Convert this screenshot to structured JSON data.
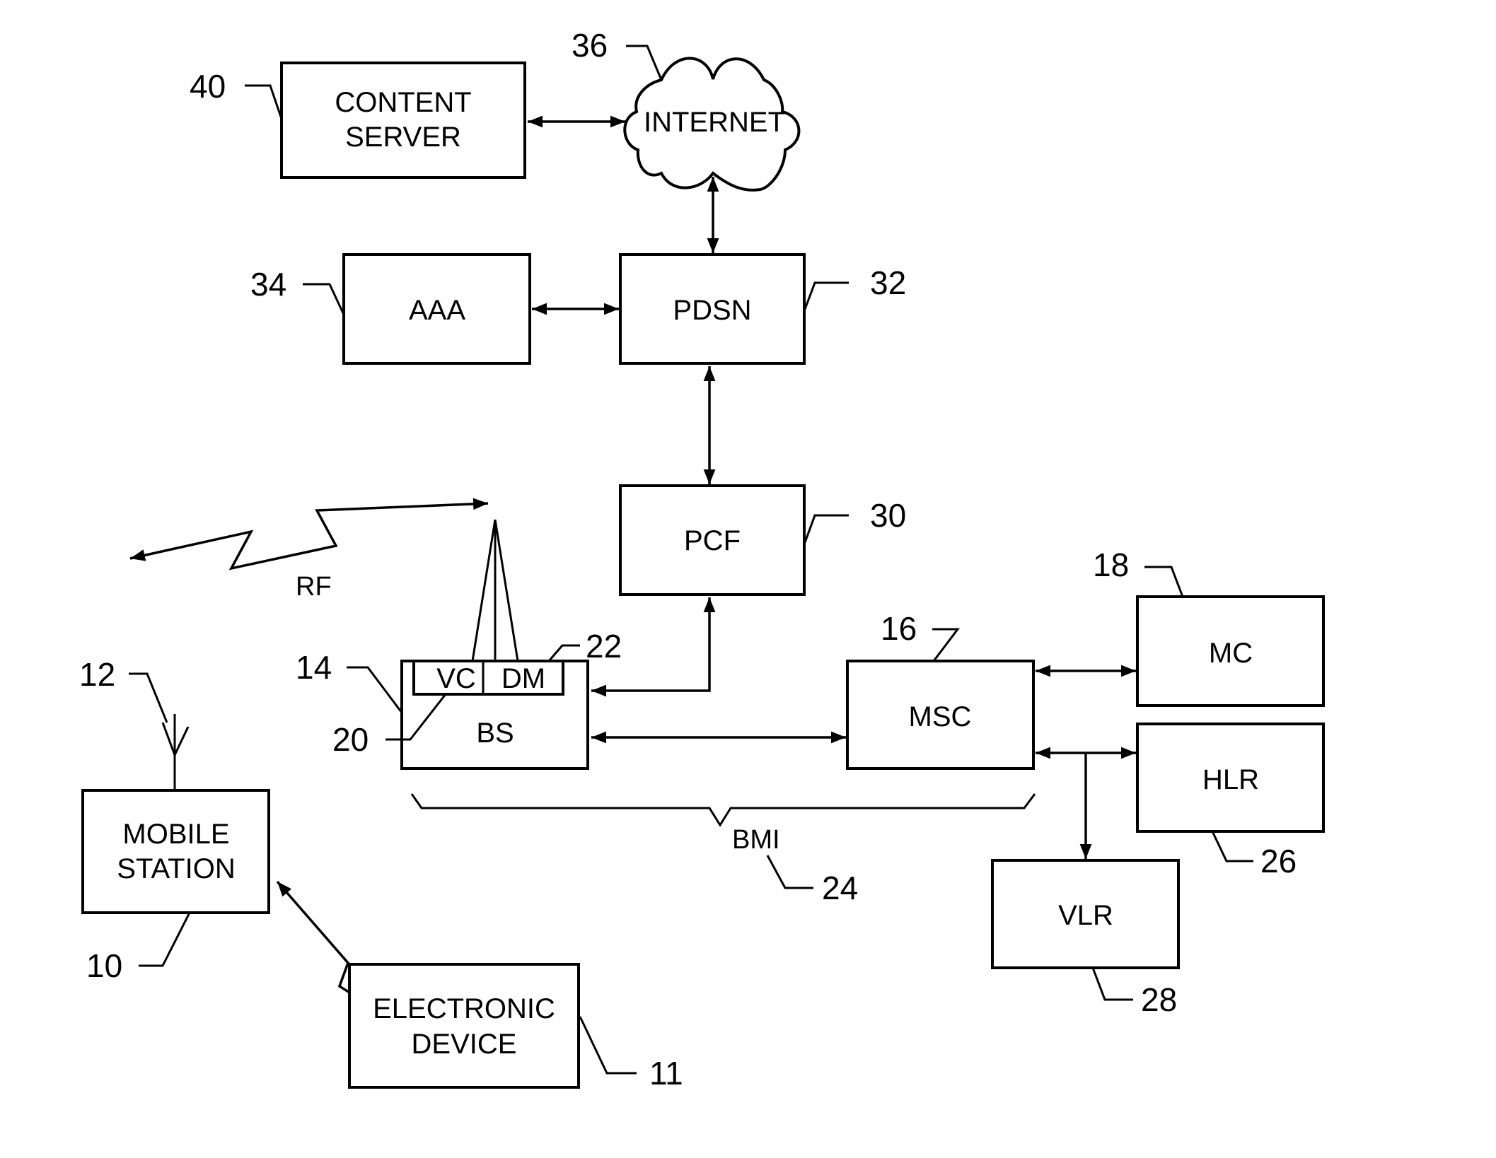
{
  "figure": {
    "nodes": {
      "content_server": {
        "line1": "CONTENT",
        "line2": "SERVER",
        "ref": "40"
      },
      "internet": {
        "label": "INTERNET",
        "ref": "36"
      },
      "aaa": {
        "label": "AAA",
        "ref": "34"
      },
      "pdsn": {
        "label": "PDSN",
        "ref": "32"
      },
      "pcf": {
        "label": "PCF",
        "ref": "30"
      },
      "bs": {
        "label": "BS",
        "ref": "14"
      },
      "vc": {
        "label": "VC",
        "ref": "20"
      },
      "dm": {
        "label": "DM",
        "ref": "22"
      },
      "msc": {
        "label": "MSC",
        "ref": "16"
      },
      "mc": {
        "label": "MC",
        "ref": "18"
      },
      "hlr": {
        "label": "HLR",
        "ref": "26"
      },
      "vlr": {
        "label": "VLR",
        "ref": "28"
      },
      "mobile_station": {
        "line1": "MOBILE",
        "line2": "STATION",
        "ref": "10"
      },
      "antenna": {
        "ref": "12"
      },
      "electronic_device": {
        "line1": "ELECTRONIC",
        "line2": "DEVICE",
        "ref": "11"
      }
    },
    "annotations": {
      "rf": "RF",
      "bmi": {
        "label": "BMI",
        "ref": "24"
      }
    }
  }
}
